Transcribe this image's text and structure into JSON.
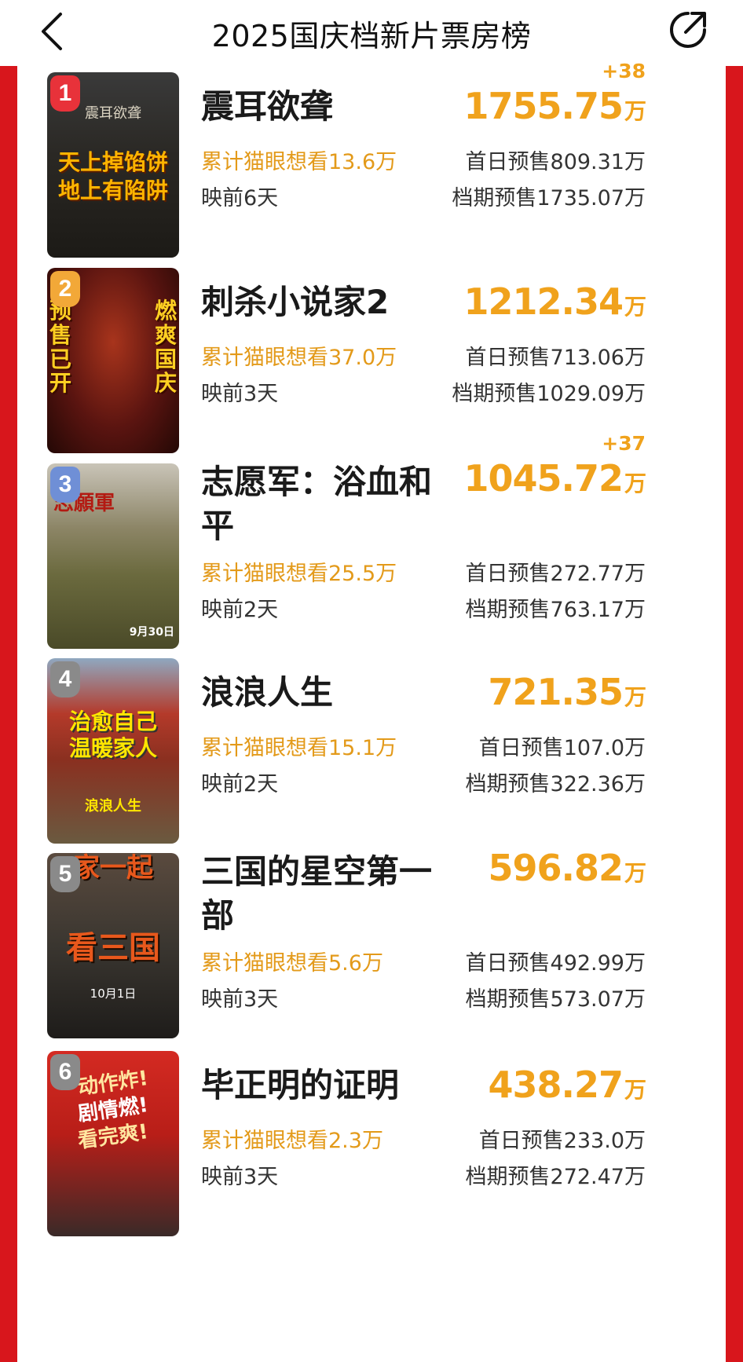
{
  "header": {
    "title": "2025国庆档新片票房榜",
    "back_icon": "chevron-left-icon",
    "share_icon": "share-arrow-icon"
  },
  "colors": {
    "brand_red": "#d8161c",
    "accent_orange": "#f0a21c",
    "want_orange": "#e39a1a",
    "badge_1": "#e8323a",
    "badge_2": "#f2a838",
    "badge_3": "#6f8fd6",
    "badge_other": "#8a8a8a"
  },
  "movies": [
    {
      "rank": "1",
      "title": "震耳欲聋",
      "want": "累计猫眼想看13.6万",
      "days": "映前6天",
      "gross": "1755.75",
      "unit": "万",
      "delta": "+38",
      "first_day": "首日预售809.31万",
      "period": "档期预售1735.07万",
      "poster_lines": [
        "天上掉馅饼",
        "地上有陷阱"
      ],
      "poster_caption": "震耳欲聋"
    },
    {
      "rank": "2",
      "title": "刺杀小说家2",
      "want": "累计猫眼想看37.0万",
      "days": "映前3天",
      "gross": "1212.34",
      "unit": "万",
      "delta": "",
      "first_day": "首日预售713.06万",
      "period": "档期预售1029.09万",
      "poster_lines": [
        "预售已开",
        "燃爽国庆"
      ],
      "poster_caption": ""
    },
    {
      "rank": "3",
      "title": "志愿军：浴血和平",
      "want": "累计猫眼想看25.5万",
      "days": "映前2天",
      "gross": "1045.72",
      "unit": "万",
      "delta": "+37",
      "first_day": "首日预售272.77万",
      "period": "档期预售763.17万",
      "poster_lines": [
        "志願軍"
      ],
      "poster_caption": "9月30日"
    },
    {
      "rank": "4",
      "title": "浪浪人生",
      "want": "累计猫眼想看15.1万",
      "days": "映前2天",
      "gross": "721.35",
      "unit": "万",
      "delta": "",
      "first_day": "首日预售107.0万",
      "period": "档期预售322.36万",
      "poster_lines": [
        "治愈自己",
        "温暖家人"
      ],
      "poster_caption": "浪浪人生"
    },
    {
      "rank": "5",
      "title": "三国的星空第一部",
      "want": "累计猫眼想看5.6万",
      "days": "映前3天",
      "gross": "596.82",
      "unit": "万",
      "delta": "",
      "first_day": "首日预售492.99万",
      "period": "档期预售573.07万",
      "poster_lines": [
        "家一起",
        "看三国"
      ],
      "poster_caption": "10月1日"
    },
    {
      "rank": "6",
      "title": "毕正明的证明",
      "want": "累计猫眼想看2.3万",
      "days": "映前3天",
      "gross": "438.27",
      "unit": "万",
      "delta": "",
      "first_day": "首日预售233.0万",
      "period": "档期预售272.47万",
      "poster_lines": [
        "动作炸!",
        "剧情燃!",
        "看完爽!"
      ],
      "poster_caption": ""
    }
  ]
}
